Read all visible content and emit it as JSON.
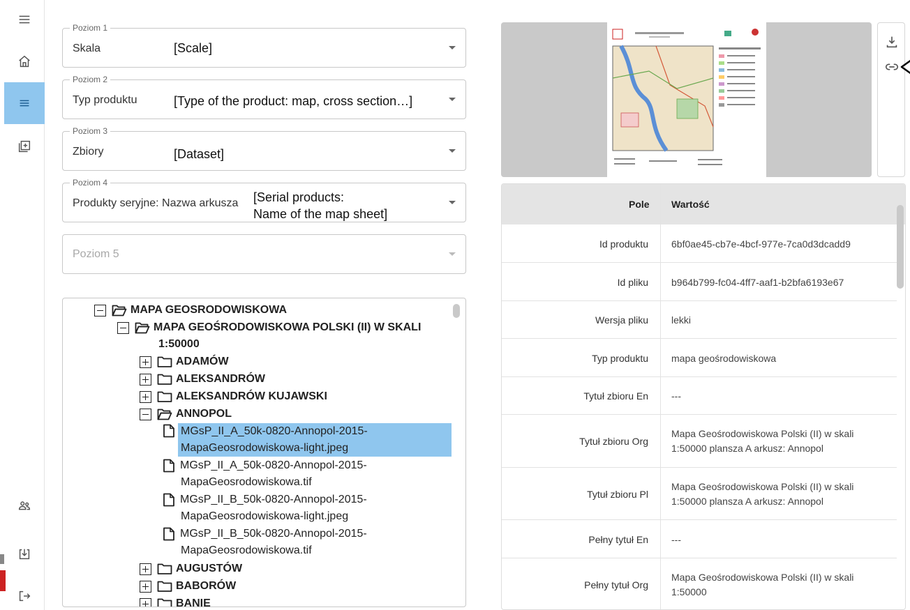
{
  "rail": {
    "menu_icon": "hamburger-icon",
    "items": [
      {
        "icon": "home-icon"
      },
      {
        "icon": "list-icon"
      },
      {
        "icon": "add-box-icon"
      },
      {
        "icon": "users-icon"
      },
      {
        "icon": "download-box-icon"
      },
      {
        "icon": "logout-icon"
      }
    ]
  },
  "levels": [
    {
      "legend": "Poziom 1",
      "value": "Skala",
      "annotation": "[Scale]"
    },
    {
      "legend": "Poziom 2",
      "value": "Typ produktu",
      "annotation": "[Type of the product: map, cross section…]"
    },
    {
      "legend": "Poziom 3",
      "value": "Zbiory",
      "annotation": "[Dataset]"
    },
    {
      "legend": "Poziom 4",
      "value": "Produkty seryjne: Nazwa arkusza",
      "annotation_line1": "[Serial products:",
      "annotation_line2": "Name of the map sheet]"
    },
    {
      "placeholder": "Poziom 5"
    }
  ],
  "tree": {
    "root": "MAPA GEOSRODOWISKOWA",
    "child": "MAPA GEOŚRODOWISKOWA POLSKI (II) W SKALI",
    "child_line2": "1:50000",
    "sheets": [
      "ADAMÓW",
      "ALEKSANDRÓW",
      "ALEKSANDRÓW KUJAWSKI",
      "ANNOPOL"
    ],
    "files": [
      {
        "line1": "MGsP_II_A_50k-0820-Annopol-2015-",
        "line2": "MapaGeosrodowiskowa-light.jpeg",
        "selected": true
      },
      {
        "line1": "MGsP_II_A_50k-0820-Annopol-2015-",
        "line2": "MapaGeosrodowiskowa.tif",
        "selected": false
      },
      {
        "line1": "MGsP_II_B_50k-0820-Annopol-2015-",
        "line2": "MapaGeosrodowiskowa-light.jpeg",
        "selected": false
      },
      {
        "line1": "MGsP_II_B_50k-0820-Annopol-2015-",
        "line2": "MapaGeosrodowiskowa.tif",
        "selected": false
      }
    ],
    "after": [
      "AUGUSTÓW",
      "BABORÓW",
      "BANIE"
    ]
  },
  "preview": {
    "download_icon": "download-icon",
    "link_icon": "link-icon"
  },
  "table": {
    "header_key": "Pole",
    "header_value": "Wartość",
    "rows": [
      {
        "key": "Id produktu",
        "value": "6bf0ae45-cb7e-4bcf-977e-7ca0d3dcadd9"
      },
      {
        "key": "Id pliku",
        "value": "b964b799-fc04-4ff7-aaf1-b2bfa6193e67"
      },
      {
        "key": "Wersja pliku",
        "value": "lekki"
      },
      {
        "key": "Typ produktu",
        "value": "mapa geośrodowiskowa"
      },
      {
        "key": "Tytuł zbioru En",
        "value": "---"
      },
      {
        "key": "Tytuł zbioru Org",
        "value_line1": "Mapa Geośrodowiskowa Polski (II) w skali",
        "value_line2": "1:50000 plansza A arkusz: Annopol"
      },
      {
        "key": "Tytuł zbioru Pl",
        "value_line1": "Mapa Geośrodowiskowa Polski (II) w skali",
        "value_line2": "1:50000 plansza A arkusz: Annopol"
      },
      {
        "key": "Pełny tytuł En",
        "value": "---"
      },
      {
        "key": "Pełny tytuł Org",
        "value_line1": "Mapa Geośrodowiskowa Polski (II) w skali",
        "value_line2": "1:50000"
      }
    ]
  },
  "colors": {
    "accent": "#8fc6ee",
    "header_bg": "#e4e4e4",
    "preview_bg": "#c9c9c9"
  }
}
